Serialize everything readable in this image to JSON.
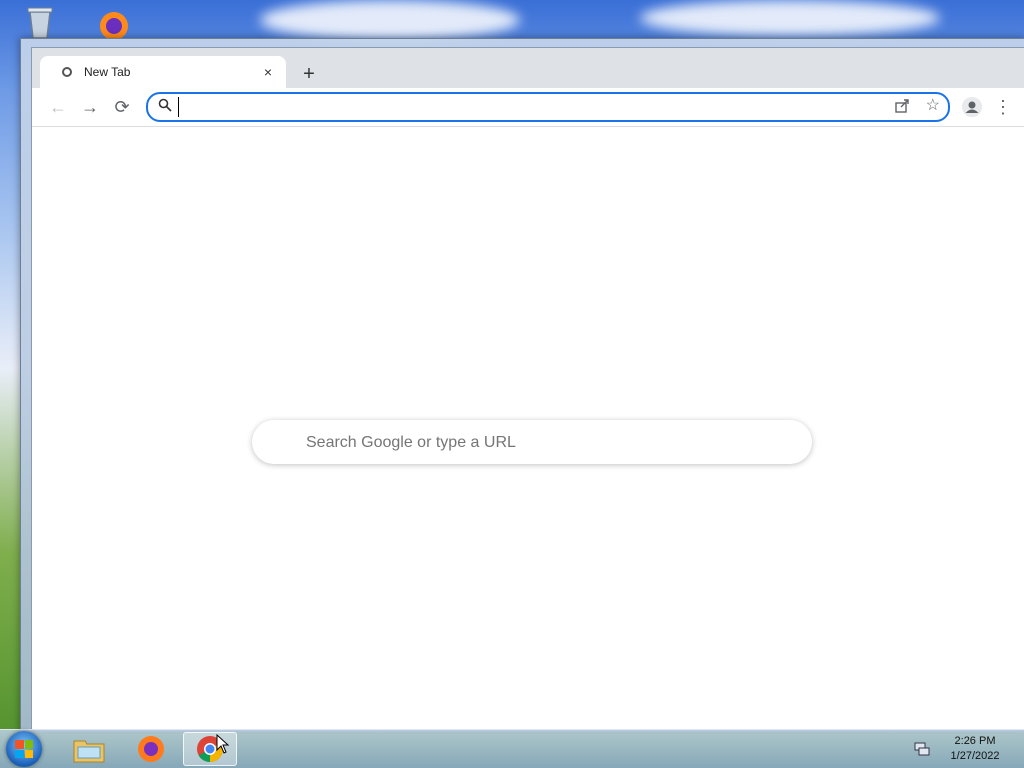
{
  "browser": {
    "tab": {
      "title": "New Tab",
      "close_label": "×"
    },
    "new_tab_label": "+",
    "toolbar": {
      "back_label": "←",
      "forward_label": "→",
      "reload_label": "⟳",
      "omnibox": {
        "value": "",
        "placeholder": ""
      },
      "star_label": "☆",
      "menu_label": "⋮"
    },
    "window_controls": {
      "minimize": "–",
      "maximize": "▭",
      "close": "✕"
    },
    "ntp": {
      "search_placeholder": "Search Google or type a URL"
    }
  },
  "taskbar": {
    "apps": [
      "file-explorer",
      "firefox",
      "chrome"
    ],
    "clock": {
      "time": "2:26 PM",
      "date": "1/27/2022"
    }
  },
  "colors": {
    "accent": "#1a73e8",
    "tab_strip": "#dee1e6"
  }
}
